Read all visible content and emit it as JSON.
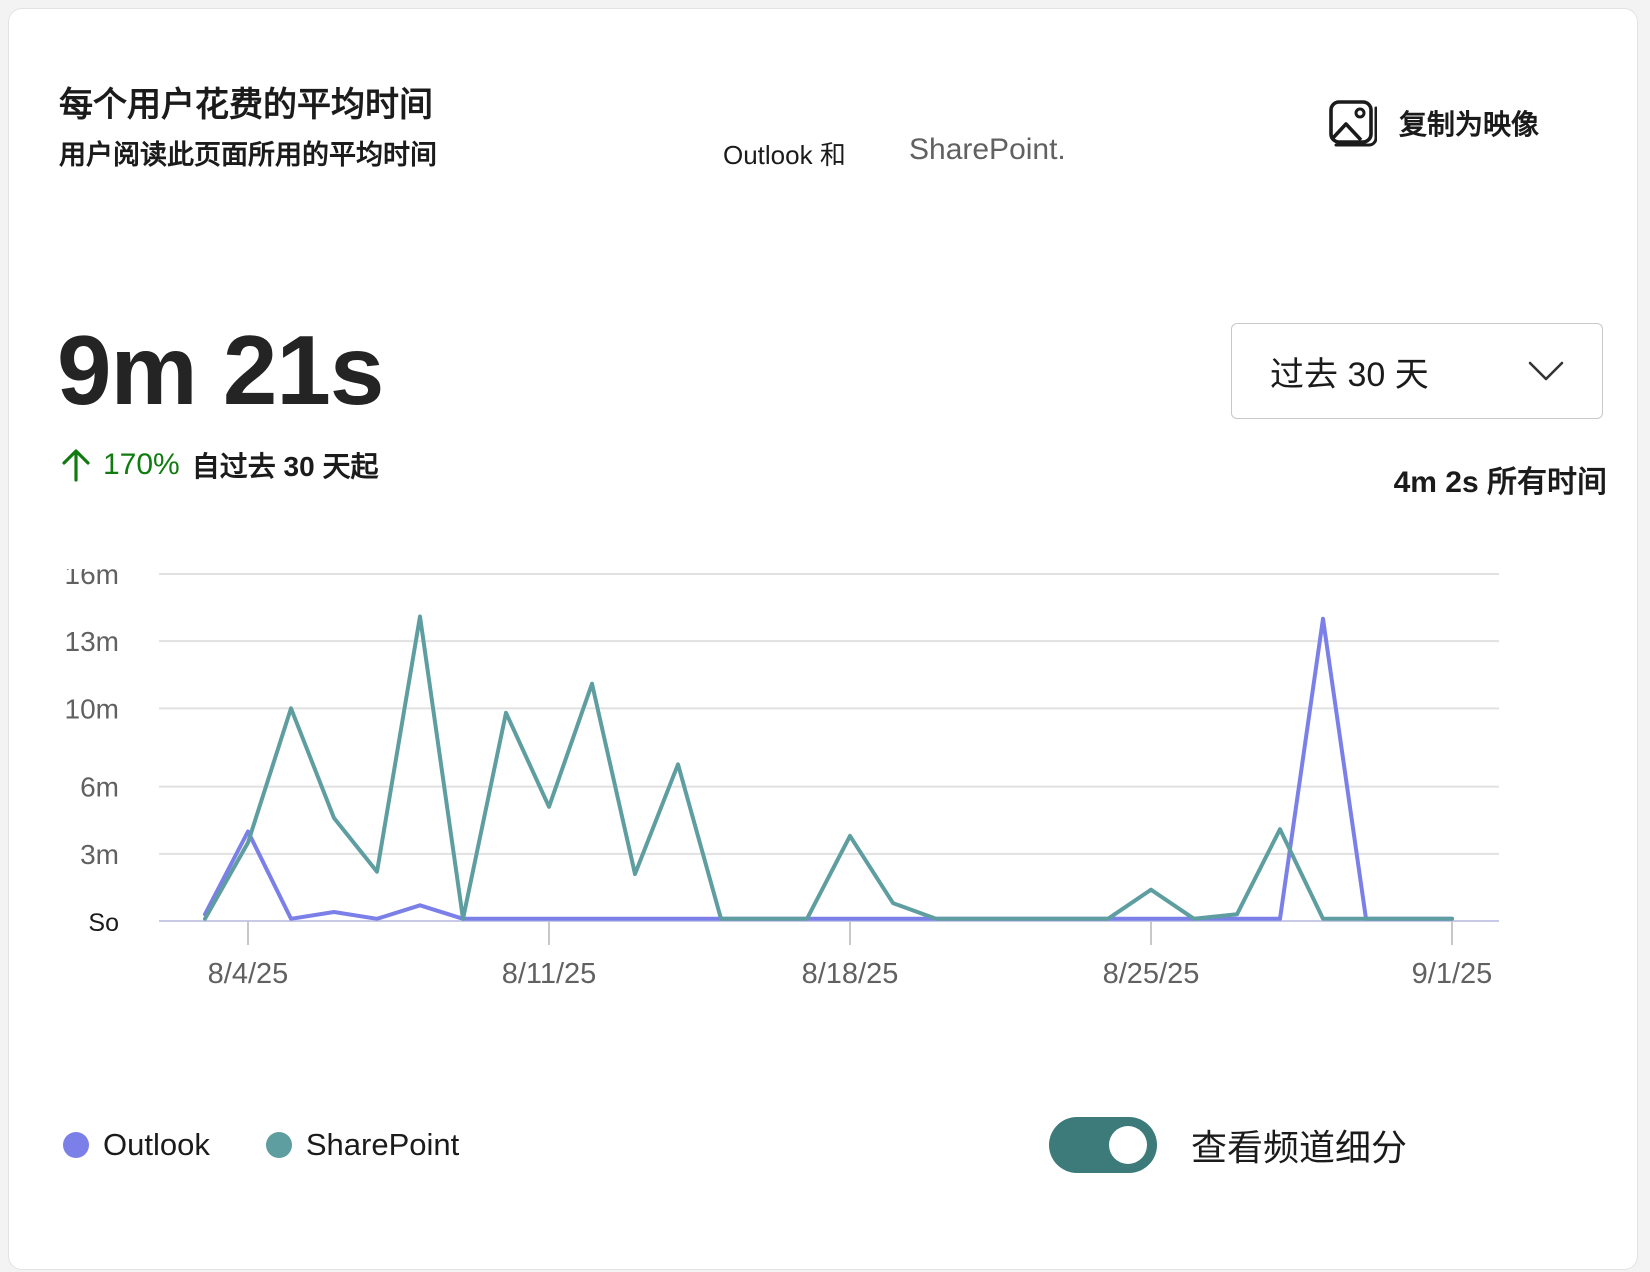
{
  "header": {
    "title": "每个用户花费的平均时间",
    "subtitle": "用户阅读此页面所用的平均时间",
    "subtitle_outlook": "Outlook 和",
    "subtitle_sharepoint": "SharePoint.",
    "copy_label": "复制为映像",
    "copy_icon": "image-icon"
  },
  "metric": {
    "value": "9m 21s",
    "change_pct": "170%",
    "change_text": "自过去 30 天起",
    "trend_icon": "arrow-up-icon",
    "all_time": "4m 2s 所有时间"
  },
  "range_dropdown": {
    "selected": "过去 30 天",
    "icon": "chevron-down-icon"
  },
  "legend": {
    "outlook": "Outlook",
    "sharepoint": "SharePoint"
  },
  "toggle": {
    "label": "查看频道细分",
    "on": true
  },
  "colors": {
    "outlook": "#7b7fe8",
    "sharepoint": "#5f9ea0",
    "trend_up": "#107c10",
    "toggle": "#3d7b7b"
  },
  "chart_data": {
    "type": "line",
    "y_tick_labels": [
      "So",
      "3m",
      "6m",
      "10m",
      "13m",
      "16m"
    ],
    "y_tick_values": [
      0,
      3,
      6,
      9.5,
      12.5,
      15.5
    ],
    "ylim": [
      0,
      15.5
    ],
    "x_tick_labels": [
      "8/4/25",
      "8/11/25",
      "8/18/25",
      "8/25/25",
      "9/1/25"
    ],
    "x_tick_index": [
      1,
      8,
      15,
      22,
      29
    ],
    "x": [
      "8/3/25",
      "8/4/25",
      "8/5/25",
      "8/6/25",
      "8/7/25",
      "8/8/25",
      "8/9/25",
      "8/10/25",
      "8/11/25",
      "8/12/25",
      "8/13/25",
      "8/14/25",
      "8/15/25",
      "8/16/25",
      "8/17/25",
      "8/18/25",
      "8/19/25",
      "8/20/25",
      "8/21/25",
      "8/22/25",
      "8/23/25",
      "8/24/25",
      "8/25/25",
      "8/26/25",
      "8/27/25",
      "8/28/25",
      "8/29/25",
      "8/30/25",
      "8/31/25",
      "9/1/25"
    ],
    "series": [
      {
        "name": "Outlook",
        "color": "#7b7fe8",
        "values": [
          0.3,
          4.0,
          0.1,
          0.4,
          0.1,
          0.7,
          0.1,
          0.1,
          0.1,
          0.1,
          0.1,
          0.1,
          0.1,
          0.1,
          0.1,
          0.1,
          0.1,
          0.1,
          0.1,
          0.1,
          0.1,
          0.1,
          0.1,
          0.1,
          0.1,
          0.1,
          13.5,
          0.1,
          0.1,
          0.1
        ]
      },
      {
        "name": "SharePoint",
        "color": "#5f9ea0",
        "values": [
          0.1,
          3.5,
          9.5,
          4.6,
          2.2,
          13.6,
          0.1,
          9.3,
          5.1,
          10.6,
          2.1,
          7.0,
          0.1,
          0.1,
          0.1,
          3.8,
          0.8,
          0.1,
          0.1,
          0.1,
          0.1,
          0.1,
          1.4,
          0.1,
          0.3,
          4.1,
          0.1,
          0.1,
          0.1,
          0.1
        ]
      }
    ],
    "grid": true
  }
}
